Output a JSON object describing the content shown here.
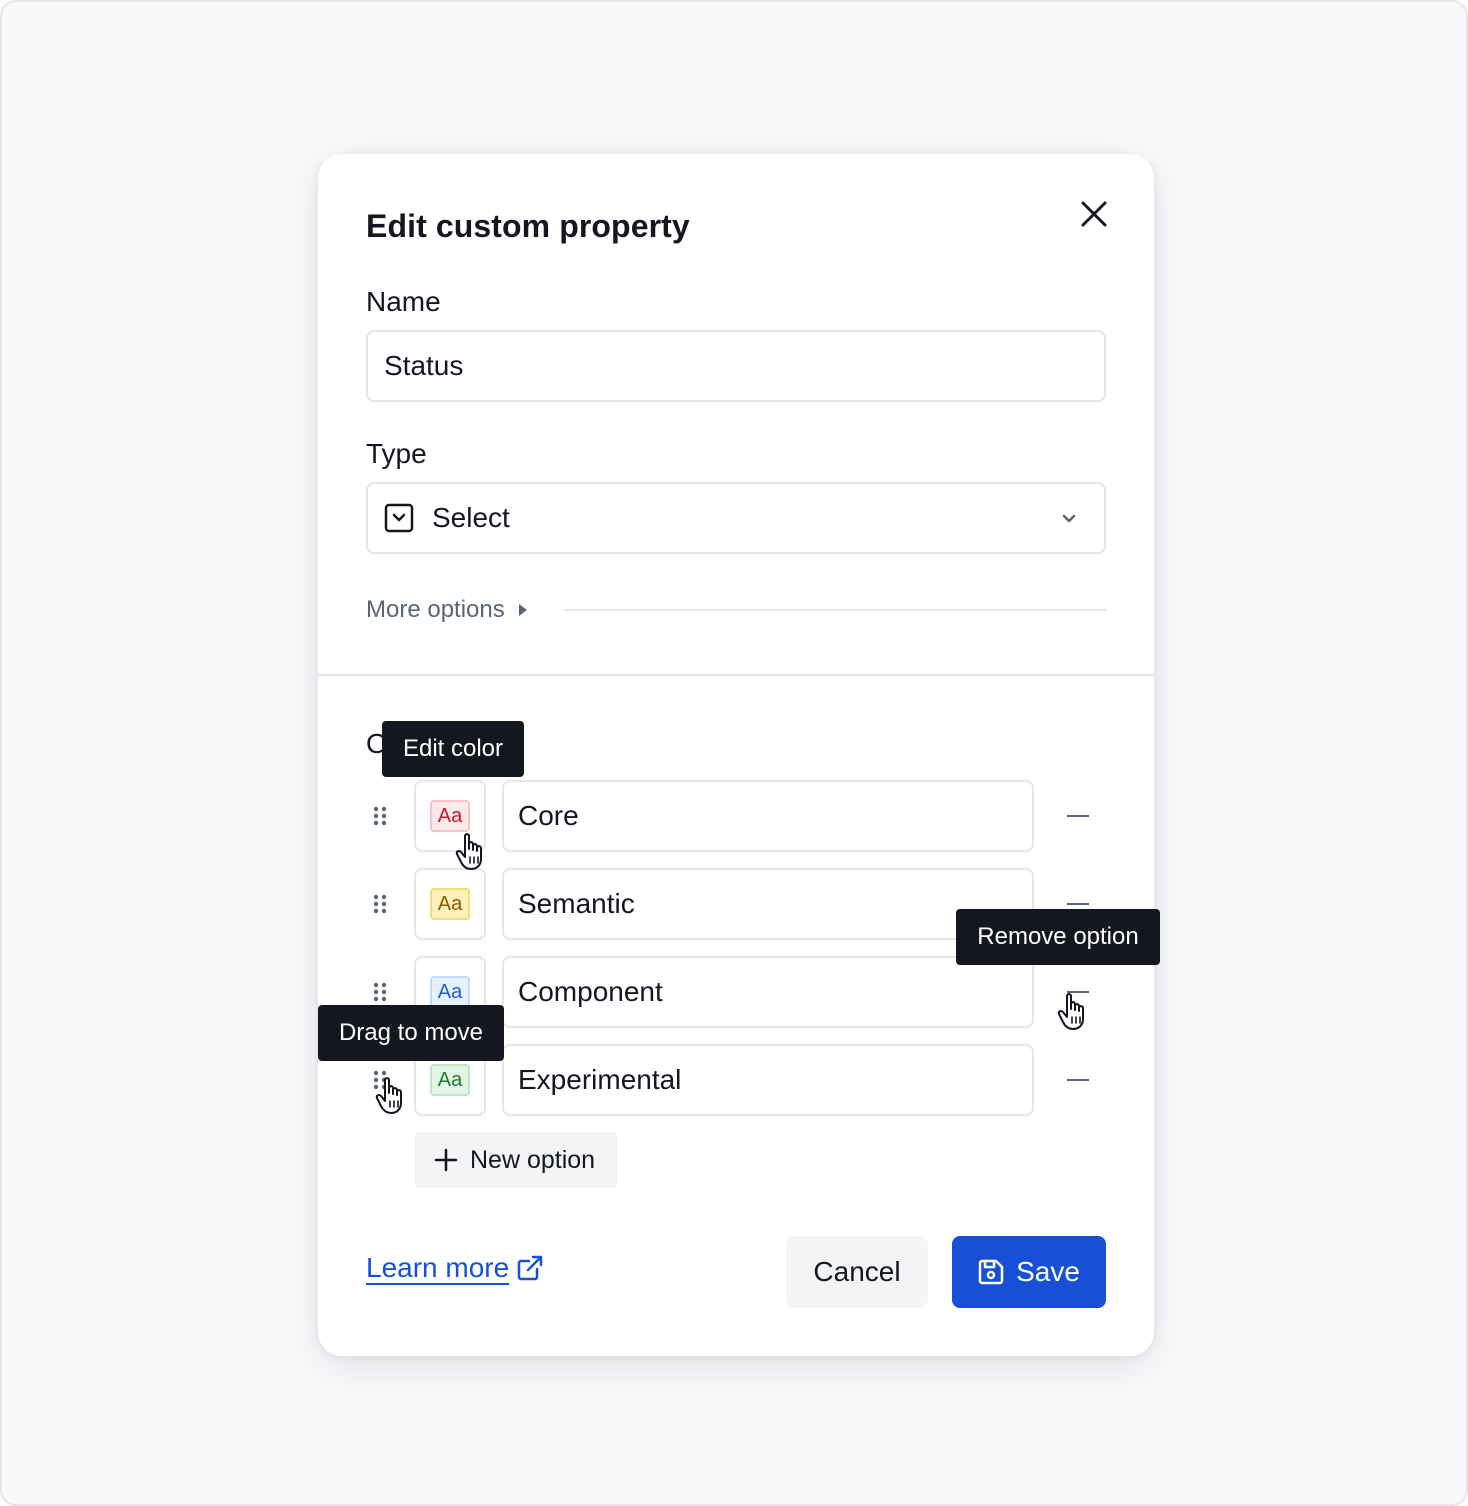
{
  "dialog": {
    "title": "Edit custom property"
  },
  "name_field": {
    "label": "Name",
    "value": "Status"
  },
  "type_field": {
    "label": "Type",
    "value": "Select",
    "icon": "select-box-icon"
  },
  "more_options": {
    "label": "More options"
  },
  "options_section": {
    "heading": "O",
    "items": [
      {
        "label": "Core",
        "chip_text": "Aa",
        "chip_bg": "#fde8ea",
        "chip_border": "#f7c1c8",
        "chip_text_color": "#c01c2c"
      },
      {
        "label": "Semantic",
        "chip_text": "Aa",
        "chip_bg": "#fff1b8",
        "chip_border": "#f3dc78",
        "chip_text_color": "#8a5a00"
      },
      {
        "label": "Component",
        "chip_text": "Aa",
        "chip_bg": "#e6f0ff",
        "chip_border": "#c2d9fb",
        "chip_text_color": "#1a5fd0"
      },
      {
        "label": "Experimental",
        "chip_text": "Aa",
        "chip_bg": "#e3f5e6",
        "chip_border": "#bfe5c6",
        "chip_text_color": "#1e7a34"
      }
    ],
    "new_option_label": "New option"
  },
  "footer": {
    "learn_more_label": "Learn more",
    "cancel_label": "Cancel",
    "save_label": "Save"
  },
  "tooltips": {
    "edit_color": "Edit color",
    "remove_option": "Remove option",
    "drag_to_move": "Drag to move"
  },
  "colors": {
    "primary": "#1750d6",
    "text": "#14171f",
    "muted": "#5b6472",
    "border": "#e4e6ea",
    "tooltip_bg": "#14171f"
  }
}
